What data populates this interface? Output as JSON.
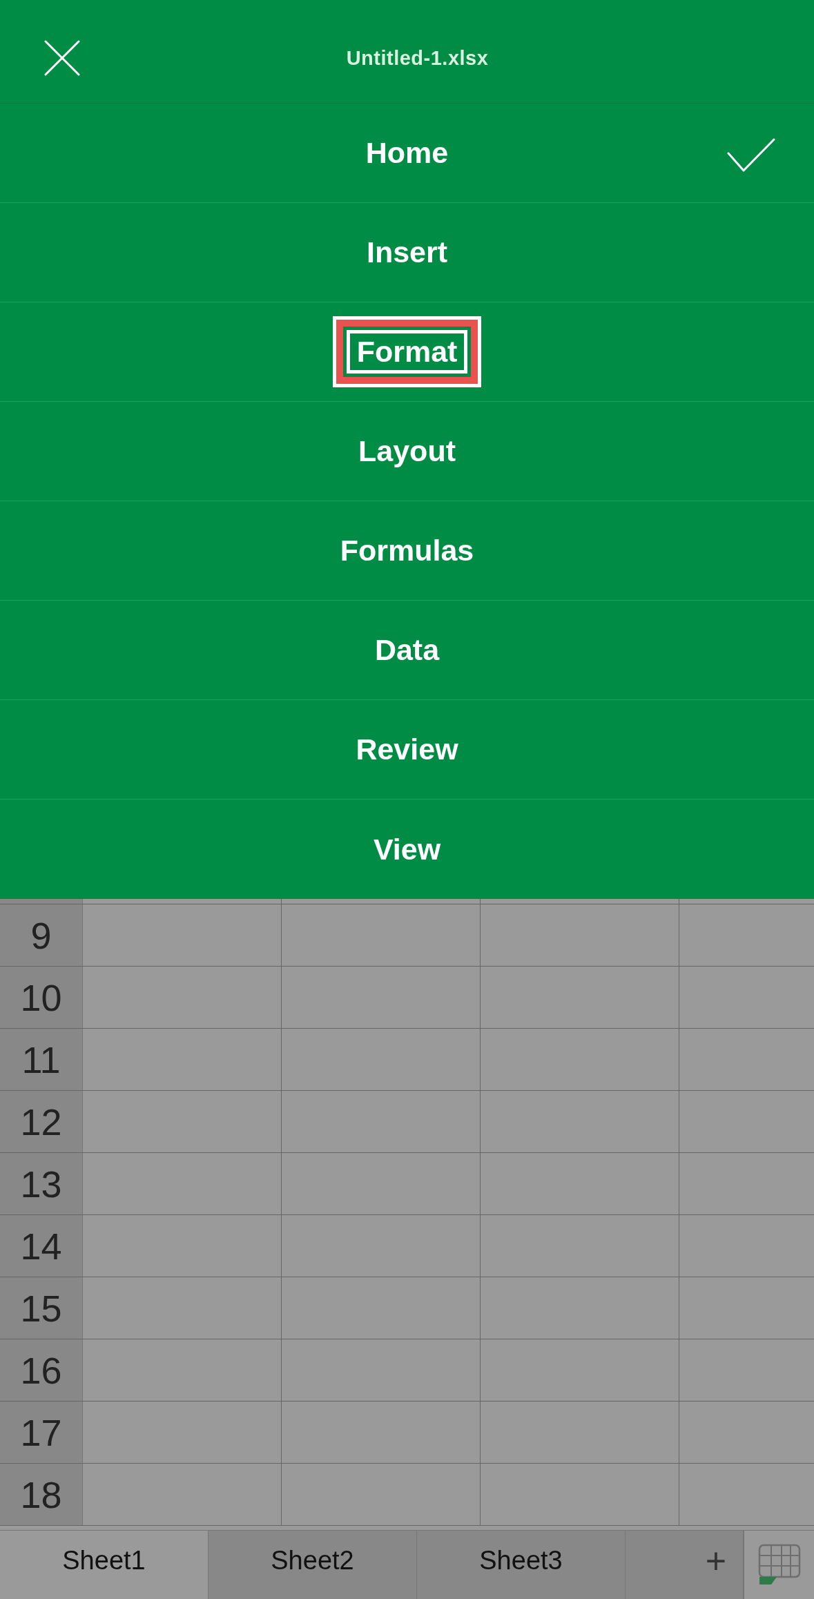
{
  "header": {
    "title": "Untitled-1.xlsx"
  },
  "menu": [
    {
      "label": "Home",
      "selected": true,
      "highlighted": false
    },
    {
      "label": "Insert",
      "selected": false,
      "highlighted": false
    },
    {
      "label": "Format",
      "selected": false,
      "highlighted": true
    },
    {
      "label": "Layout",
      "selected": false,
      "highlighted": false
    },
    {
      "label": "Formulas",
      "selected": false,
      "highlighted": false
    },
    {
      "label": "Data",
      "selected": false,
      "highlighted": false
    },
    {
      "label": "Review",
      "selected": false,
      "highlighted": false
    },
    {
      "label": "View",
      "selected": false,
      "highlighted": false
    }
  ],
  "rows": [
    "9",
    "10",
    "11",
    "12",
    "13",
    "14",
    "15",
    "16",
    "17",
    "18"
  ],
  "sheet_tabs": [
    {
      "label": "Sheet1",
      "selected": true
    },
    {
      "label": "Sheet2",
      "selected": false
    },
    {
      "label": "Sheet3",
      "selected": false
    }
  ],
  "add_sheet": "+"
}
